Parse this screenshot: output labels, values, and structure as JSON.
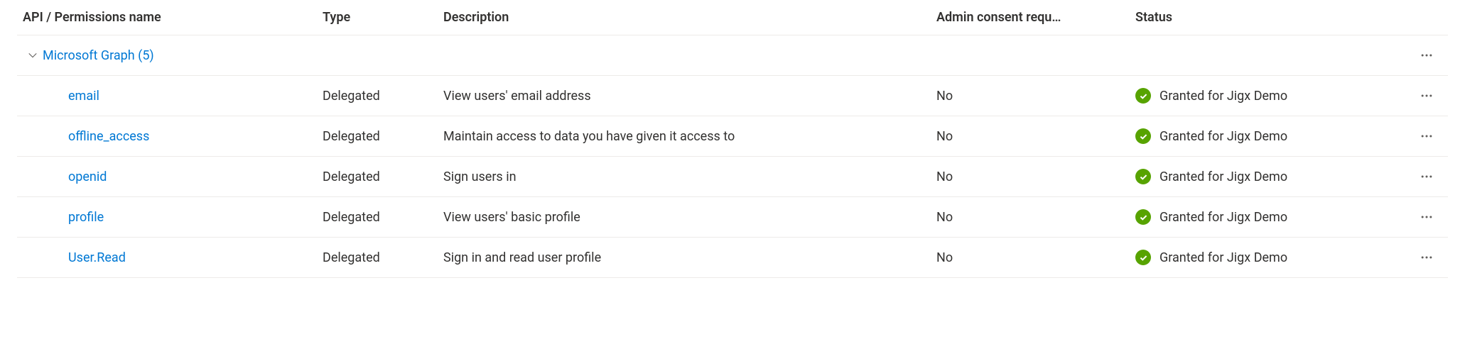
{
  "columns": {
    "name": "API / Permissions name",
    "type": "Type",
    "description": "Description",
    "admin": "Admin consent requ…",
    "status": "Status"
  },
  "group": {
    "label": "Microsoft Graph (5)"
  },
  "rows": [
    {
      "name": "email",
      "type": "Delegated",
      "description": "View users' email address",
      "admin": "No",
      "status": "Granted for Jigx Demo"
    },
    {
      "name": "offline_access",
      "type": "Delegated",
      "description": "Maintain access to data you have given it access to",
      "admin": "No",
      "status": "Granted for Jigx Demo"
    },
    {
      "name": "openid",
      "type": "Delegated",
      "description": "Sign users in",
      "admin": "No",
      "status": "Granted for Jigx Demo"
    },
    {
      "name": "profile",
      "type": "Delegated",
      "description": "View users' basic profile",
      "admin": "No",
      "status": "Granted for Jigx Demo"
    },
    {
      "name": "User.Read",
      "type": "Delegated",
      "description": "Sign in and read user profile",
      "admin": "No",
      "status": "Granted for Jigx Demo"
    }
  ]
}
